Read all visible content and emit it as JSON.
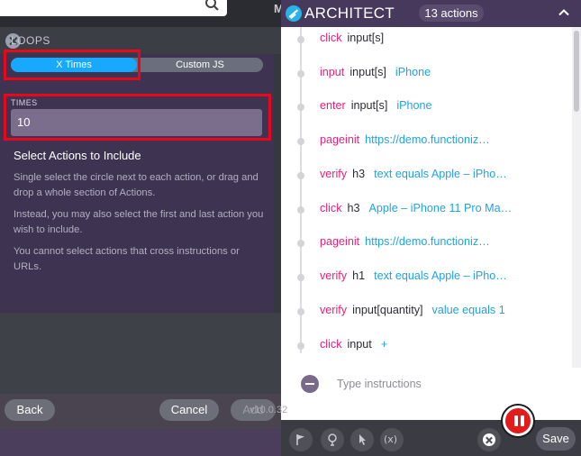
{
  "background_app": {
    "letter": "M"
  },
  "left_panel": {
    "section_title": "LOOPS",
    "mode_tabs": [
      {
        "label": "X Times",
        "selected": true
      },
      {
        "label": "Custom JS",
        "selected": false
      }
    ],
    "times_label": "TIMES",
    "times_value": "10",
    "include_title": "Select Actions to Include",
    "paragraphs": [
      "Single select the circle next to each action, or drag and drop a whole section of Actions.",
      "Instead, you may also select the first and last action you wish to include.",
      "You cannot select actions that cross instructions or URLs."
    ],
    "buttons": {
      "back": "Back",
      "cancel": "Cancel",
      "add": "Add"
    }
  },
  "right_panel": {
    "brand": "ARCHITECT",
    "action_count": "13 actions",
    "steps": [
      {
        "verb": "click",
        "target": "input[s]",
        "value": ""
      },
      {
        "verb": "input",
        "target": "input[s]",
        "value": "iPhone"
      },
      {
        "verb": "enter",
        "target": "input[s]",
        "value": "iPhone"
      },
      {
        "verb": "pageinit",
        "target": "",
        "value": "https://demo.functioniz…"
      },
      {
        "verb": "verify",
        "target": "h3",
        "value": "text equals Apple – iPho…"
      },
      {
        "verb": "click",
        "target": "h3",
        "value": "Apple – iPhone 11 Pro Ma…"
      },
      {
        "verb": "pageinit",
        "target": "",
        "value": "https://demo.functioniz…"
      },
      {
        "verb": "verify",
        "target": "h1",
        "value": "text equals Apple – iPho…"
      },
      {
        "verb": "verify",
        "target": "input[quantity]",
        "value": "value equals 1"
      },
      {
        "verb": "click",
        "target": "input",
        "value": "+"
      }
    ],
    "instruction_placeholder": "Type instructions",
    "version": "v10.0.32",
    "save_label": "Save",
    "footer_tools": [
      "flag-icon",
      "lightbulb-icon",
      "pointer-icon",
      "function-icon"
    ],
    "function_glyph": "(x)"
  },
  "colors": {
    "accent_blue": "#18a9ff",
    "highlight_red": "#e8071c",
    "verb_pink": "#ea1f7a",
    "value_blue": "#23a2e0",
    "header_purple": "#47395b"
  }
}
